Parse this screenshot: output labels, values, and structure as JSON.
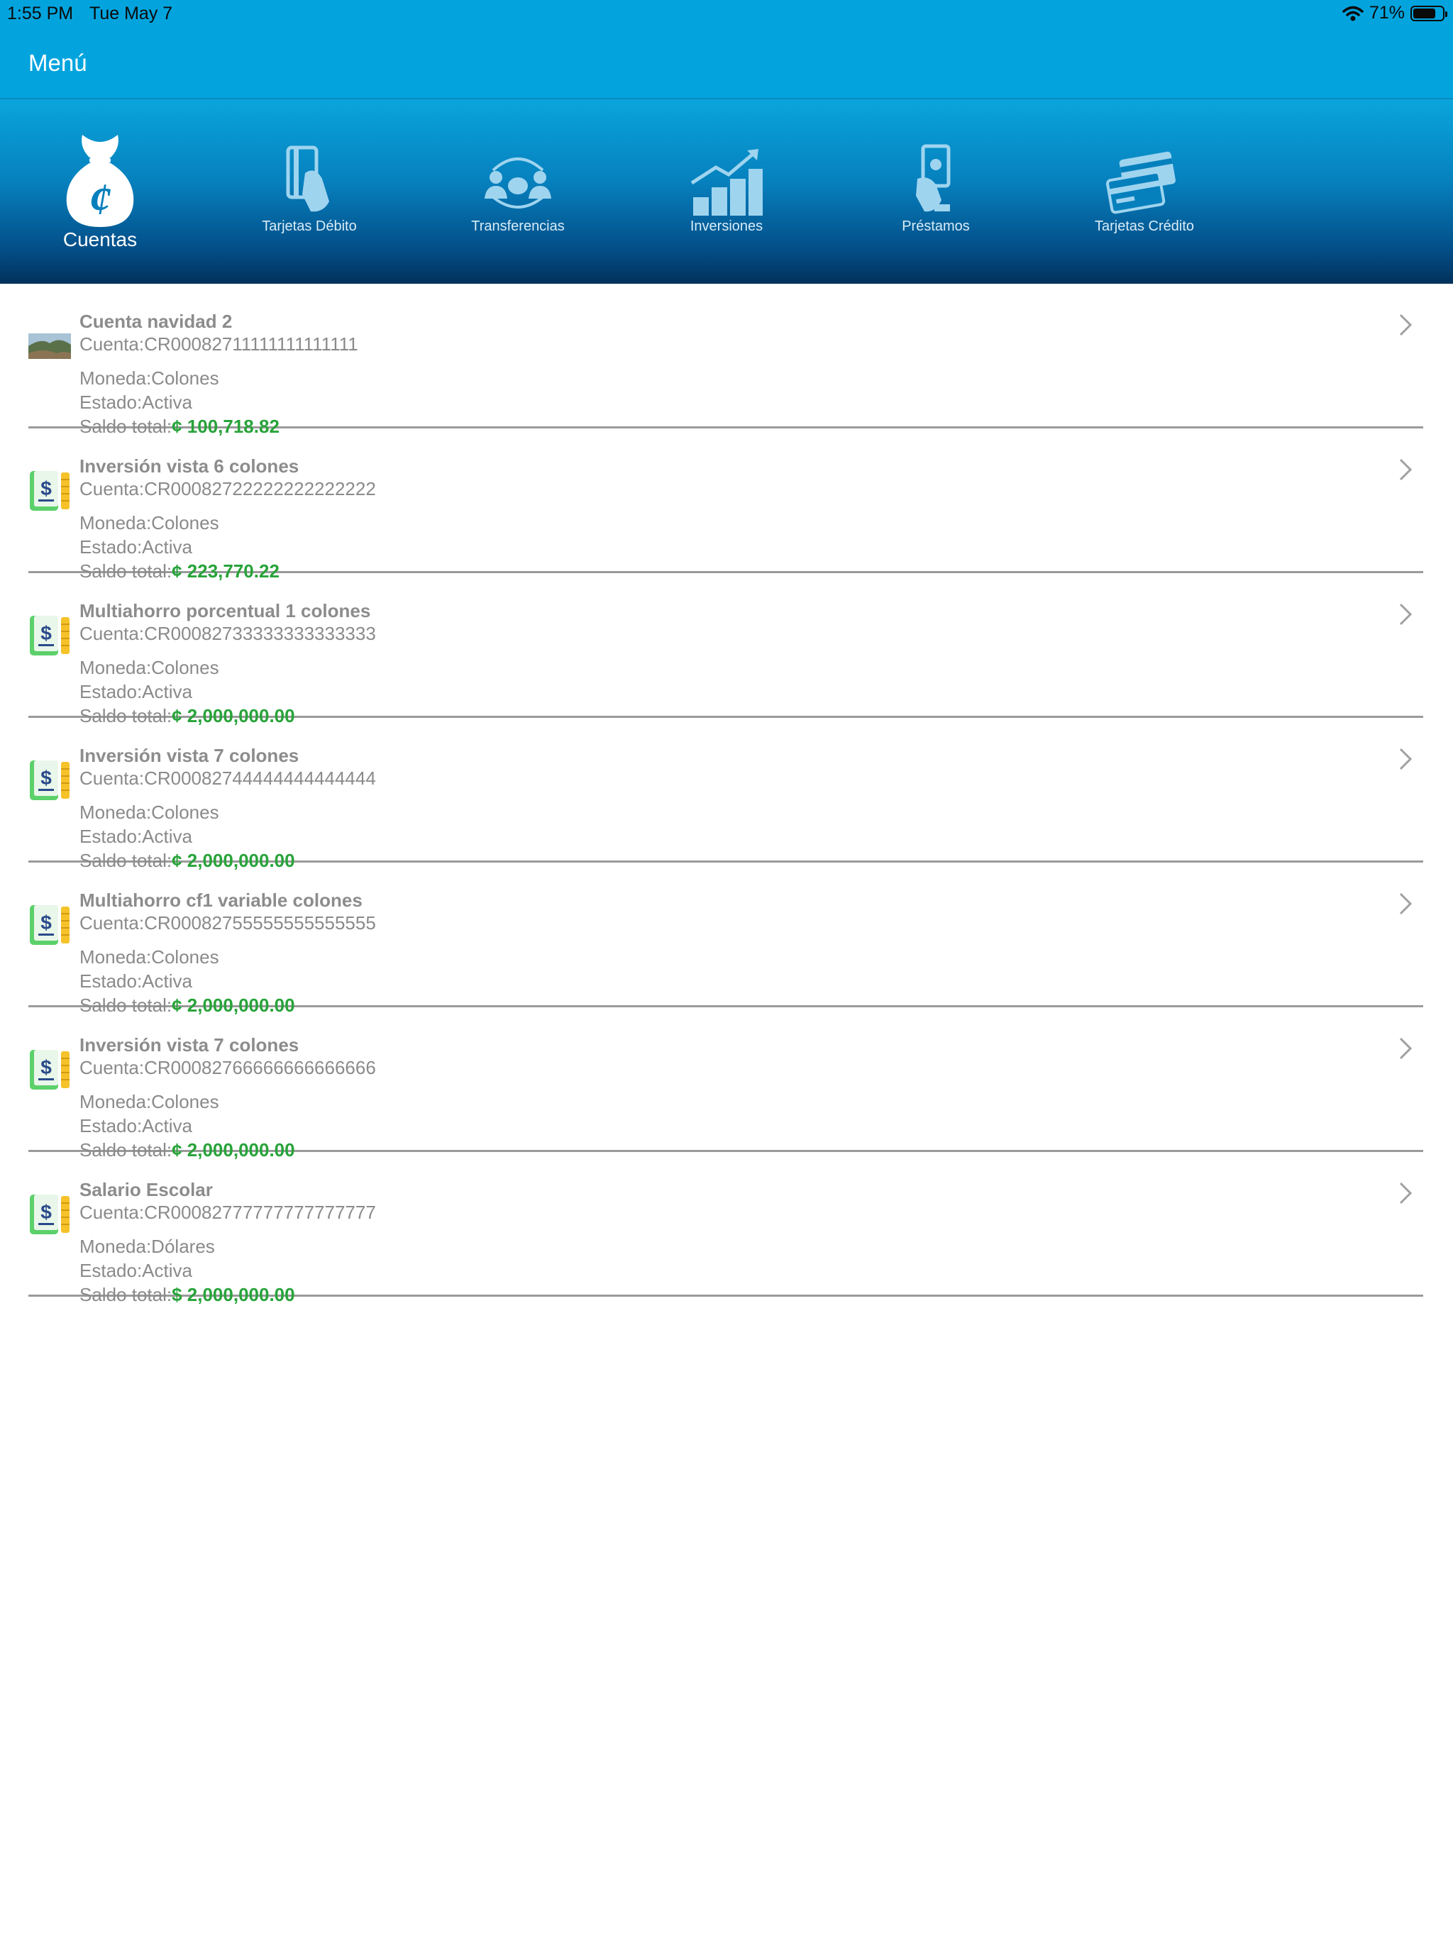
{
  "status_bar": {
    "time": "1:55 PM",
    "date": "Tue May 7",
    "battery": "71%"
  },
  "nav": {
    "title": "Menú"
  },
  "categories": [
    {
      "label": "Cuentas",
      "icon": "money-bag-colon-icon",
      "active": true
    },
    {
      "label": "Tarjetas Débito",
      "icon": "debit-card-icon"
    },
    {
      "label": "Transferencias",
      "icon": "transfer-people-icon"
    },
    {
      "label": "Inversiones",
      "icon": "investment-chart-icon"
    },
    {
      "label": "Préstamos",
      "icon": "loan-hand-cash-icon"
    },
    {
      "label": "Tarjetas Crédito",
      "icon": "credit-cards-icon"
    }
  ],
  "accounts": [
    {
      "name": "Cuenta navidad 2",
      "account": "Cuenta:CR00082711111111111111",
      "moneda": "Moneda:Colones",
      "estado": "Estado:Activa",
      "saldo_label": "Saldo total:",
      "saldo": "¢ 100,718.82",
      "thumb": "landscape-photo"
    },
    {
      "name": "Inversión vista 6 colones",
      "account": "Cuenta:CR00082722222222222222",
      "moneda": "Moneda:Colones",
      "estado": "Estado:Activa",
      "saldo_label": "Saldo total:",
      "saldo": "¢ 223,770.22",
      "thumb": "savings-book-icon"
    },
    {
      "name": "Multiahorro porcentual 1 colones",
      "account": "Cuenta:CR00082733333333333333",
      "moneda": "Moneda:Colones",
      "estado": "Estado:Activa",
      "saldo_label": "Saldo total:",
      "saldo": "¢ 2,000,000.00",
      "thumb": "savings-book-icon"
    },
    {
      "name": "Inversión vista 7 colones",
      "account": "Cuenta:CR00082744444444444444",
      "moneda": "Moneda:Colones",
      "estado": "Estado:Activa",
      "saldo_label": "Saldo total:",
      "saldo": "¢ 2,000,000.00",
      "thumb": "savings-book-icon"
    },
    {
      "name": "Multiahorro cf1 variable colones",
      "account": "Cuenta:CR00082755555555555555",
      "moneda": "Moneda:Colones",
      "estado": "Estado:Activa",
      "saldo_label": "Saldo total:",
      "saldo": "¢ 2,000,000.00",
      "thumb": "savings-book-icon"
    },
    {
      "name": "Inversión vista 7 colones",
      "account": "Cuenta:CR00082766666666666666",
      "moneda": "Moneda:Colones",
      "estado": "Estado:Activa",
      "saldo_label": "Saldo total:",
      "saldo": "¢ 2,000,000.00",
      "thumb": "savings-book-icon"
    },
    {
      "name": "Salario Escolar",
      "account": "Cuenta:CR00082777777777777777",
      "moneda": "Moneda:Dólares",
      "estado": "Estado:Activa",
      "saldo_label": "Saldo total:",
      "saldo": "$ 2,000,000.00",
      "thumb": "savings-book-icon"
    }
  ],
  "colors": {
    "header": "#03a4de",
    "amount_green": "#28a33a",
    "text_gray": "#8a8a8a"
  }
}
